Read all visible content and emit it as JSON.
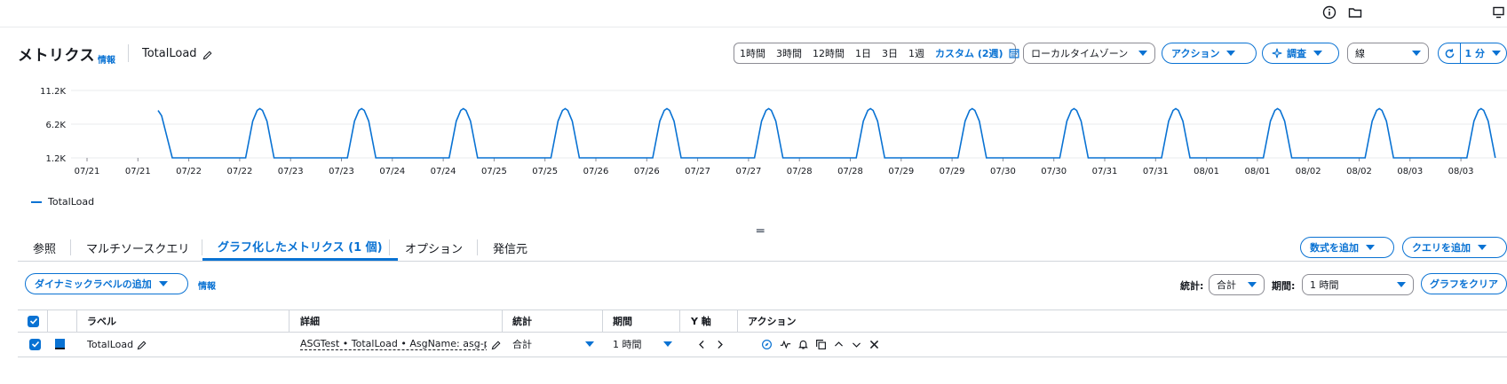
{
  "header": {
    "title": "メトリクス",
    "info": "情報",
    "metric_name": "TotalLoad"
  },
  "time_range": {
    "options": [
      "1時間",
      "3時間",
      "12時間",
      "1日",
      "3日",
      "1週"
    ],
    "custom": "カスタム (2週)"
  },
  "toolbar": {
    "timezone": "ローカルタイムゾーン",
    "actions": "アクション",
    "investigate": "調査",
    "graph_type": "線",
    "refresh_interval": "1 分"
  },
  "chart_data": {
    "type": "line",
    "y_ticks": [
      "11.2K",
      "6.2K",
      "1.2K"
    ],
    "y_tick_values": [
      11200,
      6200,
      1200
    ],
    "ylim": [
      1200,
      11200
    ],
    "x_tick_labels": [
      "07/21",
      "07/21",
      "07/22",
      "07/22",
      "07/23",
      "07/23",
      "07/24",
      "07/24",
      "07/25",
      "07/25",
      "07/26",
      "07/26",
      "07/27",
      "07/27",
      "07/28",
      "07/28",
      "07/29",
      "07/29",
      "07/30",
      "07/30",
      "07/31",
      "07/31",
      "08/01",
      "08/01",
      "08/02",
      "08/02",
      "08/03",
      "08/03"
    ],
    "grid": true,
    "legend_placement": "bottom-left",
    "series": [
      {
        "name": "TotalLoad",
        "color": "#0972d3",
        "peak": 8500,
        "baseline": 1200,
        "period_days": 1
      }
    ]
  },
  "tabs": [
    {
      "label": "参照"
    },
    {
      "label": "マルチソースクエリ"
    },
    {
      "label": "グラフ化したメトリクス (1 個)"
    },
    {
      "label": "オプション"
    },
    {
      "label": "発信元"
    }
  ],
  "buttons": {
    "add_math": "数式を追加",
    "add_query": "クエリを追加",
    "add_dynamic_label": "ダイナミックラベルの追加",
    "dynamic_label_info": "情報",
    "clear_graph": "グラフをクリア"
  },
  "stat_controls": {
    "statistic_label": "統計:",
    "statistic_value": "合計",
    "period_label": "期間:",
    "period_value": "1 時間"
  },
  "table": {
    "columns": [
      "ラベル",
      "詳細",
      "統計",
      "期間",
      "Y 軸",
      "アクション"
    ],
    "rows": [
      {
        "label": "TotalLoad",
        "detail": "ASGTest • TotalLoad • AsgName: asg-pred",
        "stat": "合計",
        "period": "1 時間",
        "color": "#0972d3"
      }
    ]
  }
}
